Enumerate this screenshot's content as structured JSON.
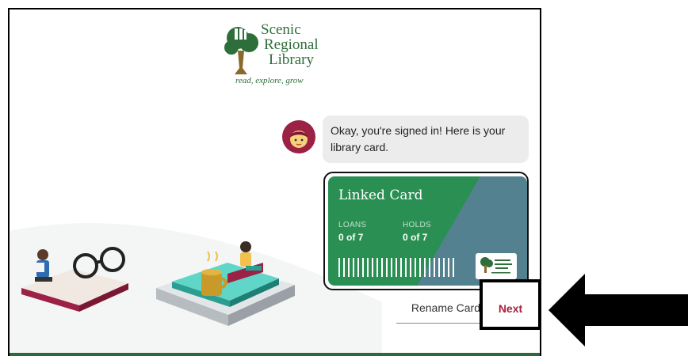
{
  "logo": {
    "name_lines": [
      "Scenic",
      "Regional",
      "Library"
    ],
    "tagline": "read, explore, grow"
  },
  "chat": {
    "message": "Okay, you're signed in! Here is your library card."
  },
  "card": {
    "title": "Linked Card",
    "loans_label": "LOANS",
    "loans_value": "0 of 7",
    "holds_label": "HOLDS",
    "holds_value": "0 of 7",
    "colors": {
      "primary": "#2a8f53",
      "secondary": "#53818f"
    }
  },
  "actions": {
    "rename_label": "Rename Card",
    "next_label": "Next"
  },
  "icons": [
    "library-tree-logo-icon",
    "libby-avatar-icon",
    "arrow-left-icon"
  ],
  "colors": {
    "brand_green": "#2e6e3b",
    "accent": "#a8213f"
  }
}
